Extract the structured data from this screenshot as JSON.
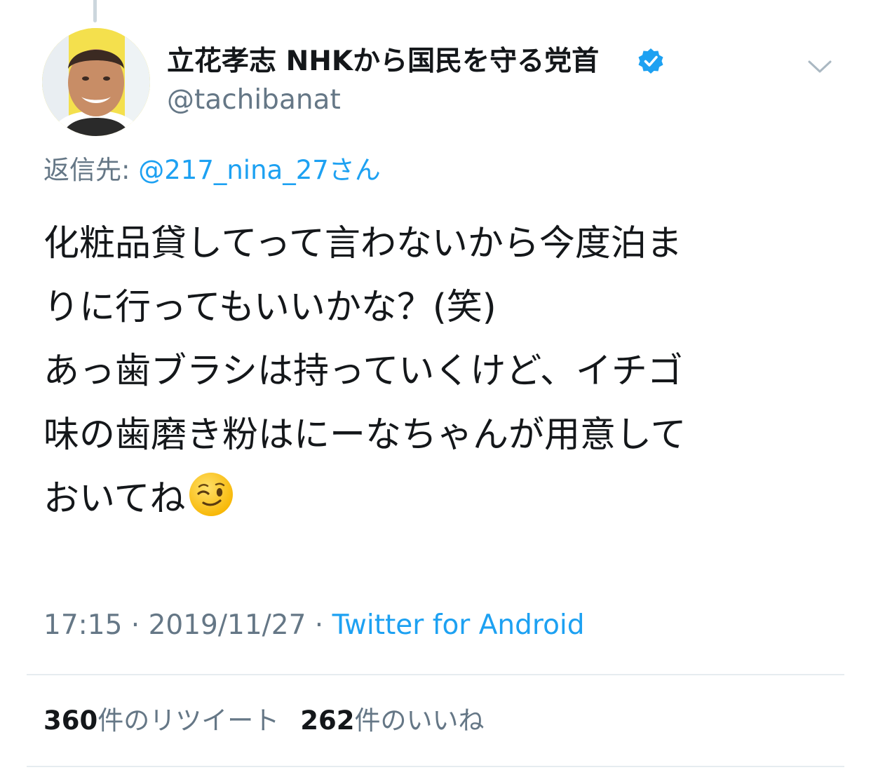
{
  "tweet": {
    "author": {
      "display_name": "立花孝志 NHKから国民を守る党首",
      "handle": "@tachibanat",
      "verified": true
    },
    "reply_to": {
      "prefix": "返信先: ",
      "mention": "@217_nina_27",
      "suffix": "さん"
    },
    "text_lines": [
      "化粧品貸してって言わないから今度泊ま",
      "りに行ってもいいかな？(笑)",
      "あっ歯ブラシは持っていくけど、イチゴ",
      "味の歯磨き粉はにーなちゃんが用意して",
      "おいてね"
    ],
    "emoji": "winking-face",
    "time": "17:15",
    "separator": " · ",
    "date": "2019/11/27",
    "source": "Twitter for Android",
    "stats": {
      "retweets_count": "360",
      "retweets_label": "件のリツイート",
      "likes_count": "262",
      "likes_label": "件のいいね"
    }
  },
  "colors": {
    "link": "#1da1f2",
    "secondary_text": "#657786",
    "primary_text": "#14171a",
    "divider": "#e6ecf0"
  }
}
